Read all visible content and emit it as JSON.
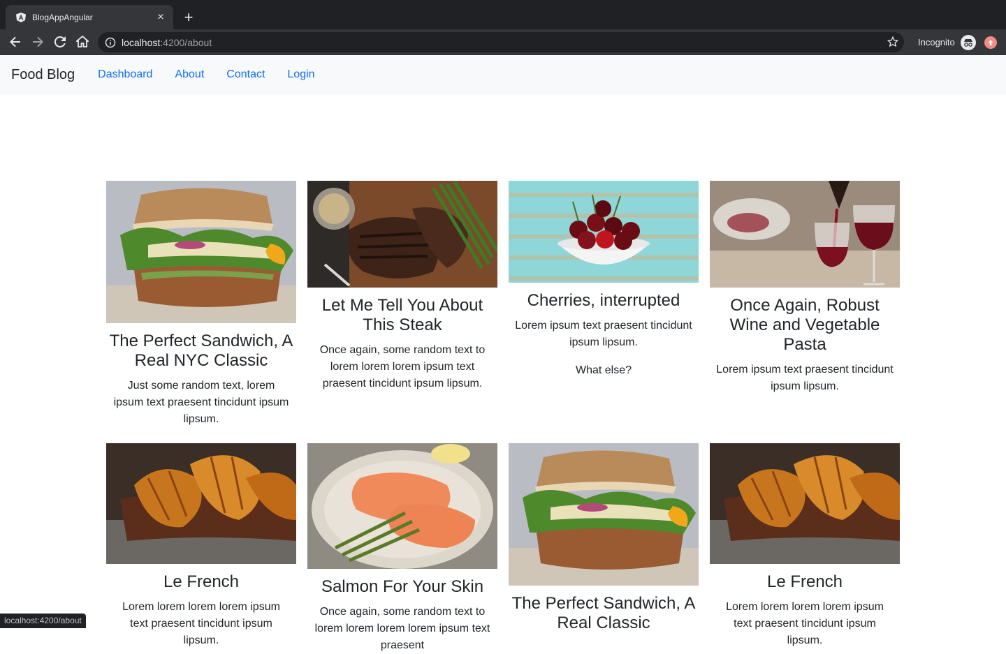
{
  "browser": {
    "tab_title": "BlogAppAngular",
    "new_tab": "+",
    "close": "×",
    "url_host": "localhost",
    "url_path": ":4200/about",
    "incognito_label": "Incognito",
    "status_url": "localhost:4200/about"
  },
  "navbar": {
    "brand": "Food Blog",
    "links": [
      "Dashboard",
      "About",
      "Contact",
      "Login"
    ]
  },
  "cards": [
    {
      "title": "The Perfect Sandwich, A Real NYC Classic",
      "text": "Just some random text, lorem ipsum text praesent tincidunt ipsum lipsum.",
      "extra": "",
      "image": "sandwich-image"
    },
    {
      "title": "Let Me Tell You About This Steak",
      "text": "Once again, some random text to lorem lorem lorem ipsum text praesent tincidunt ipsum lipsum.",
      "extra": "",
      "image": "steak-image"
    },
    {
      "title": "Cherries, interrupted",
      "text": "Lorem ipsum text praesent tincidunt ipsum lipsum.",
      "extra": "What else?",
      "image": "cherries-image"
    },
    {
      "title": "Once Again, Robust Wine and Vegetable Pasta",
      "text": "Lorem ipsum text praesent tincidunt ipsum lipsum.",
      "extra": "",
      "image": "wine-image"
    },
    {
      "title": "Le French",
      "text": "Lorem lorem lorem lorem ipsum text praesent tincidunt ipsum lipsum.",
      "extra": "",
      "image": "croissant-image"
    },
    {
      "title": "Salmon For Your Skin",
      "text": "Once again, some random text to lorem lorem lorem lorem ipsum text praesent",
      "extra": "",
      "image": "salmon-image"
    },
    {
      "title": "The Perfect Sandwich, A Real Classic",
      "text": "",
      "extra": "",
      "image": "sandwich-image"
    },
    {
      "title": "Le French",
      "text": "Lorem lorem lorem lorem ipsum text praesent tincidunt ipsum lipsum.",
      "extra": "",
      "image": "croissant-image"
    }
  ]
}
